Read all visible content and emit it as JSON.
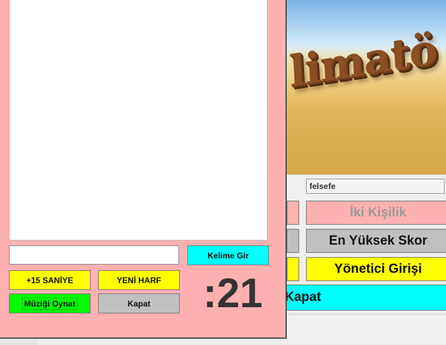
{
  "background_window": {
    "banner_text": "limatö",
    "topic_input_value": "felsefe",
    "buttons": {
      "iki_kisilik": "İki Kişilik",
      "en_yuksek_skor": "En Yüksek Skor",
      "yonetici_girisi": "Yönetici Girişi",
      "kapat": "Kapat"
    }
  },
  "game_window": {
    "word_input_value": "",
    "buttons": {
      "kelime_gir": "Kelime Gir",
      "saniye": "+15 SANİYE",
      "yeni_harf": "YENİ HARF",
      "muzik": "Müziği Oynat",
      "kapat": "Kapat"
    },
    "timer": ":21"
  },
  "colors": {
    "game_bg": "#ffb1b1",
    "cyan": "#00ffff",
    "yellow": "#ffff00",
    "green": "#00ff00",
    "gray": "#c0c0c0"
  }
}
